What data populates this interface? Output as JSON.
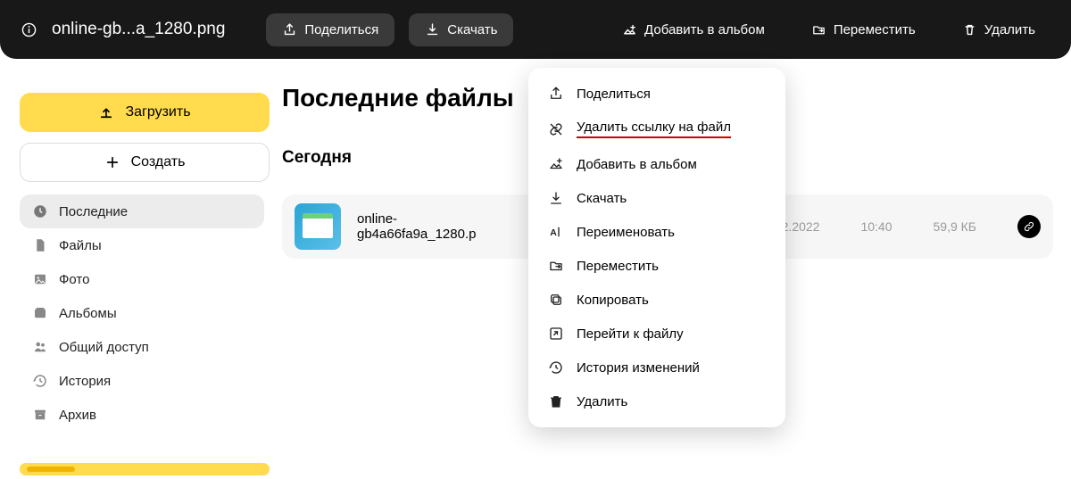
{
  "topbar": {
    "filename": "online-gb...a_1280.png",
    "share": "Поделиться",
    "download": "Скачать",
    "add_album": "Добавить в альбом",
    "move": "Переместить",
    "delete": "Удалить"
  },
  "sidebar": {
    "upload": "Загрузить",
    "create": "Создать",
    "items": [
      {
        "label": "Последние",
        "icon": "clock"
      },
      {
        "label": "Файлы",
        "icon": "file"
      },
      {
        "label": "Фото",
        "icon": "image"
      },
      {
        "label": "Альбомы",
        "icon": "album"
      },
      {
        "label": "Общий доступ",
        "icon": "shared"
      },
      {
        "label": "История",
        "icon": "history"
      },
      {
        "label": "Архив",
        "icon": "archive"
      }
    ]
  },
  "content": {
    "title": "Последние файлы",
    "section": "Сегодня",
    "file": {
      "name": "online-gb4a66fa9a_1280.p",
      "date": "14.12.2022",
      "time": "10:40",
      "size": "59,9 КБ"
    }
  },
  "context_menu": [
    {
      "label": "Поделиться",
      "icon": "share"
    },
    {
      "label": "Удалить ссылку на файл",
      "icon": "unlink",
      "highlight": true
    },
    {
      "label": "Добавить в альбом",
      "icon": "album-add"
    },
    {
      "label": "Скачать",
      "icon": "download"
    },
    {
      "label": "Переименовать",
      "icon": "rename"
    },
    {
      "label": "Переместить",
      "icon": "move"
    },
    {
      "label": "Копировать",
      "icon": "copy"
    },
    {
      "label": "Перейти к файлу",
      "icon": "goto"
    },
    {
      "label": "История изменений",
      "icon": "history"
    },
    {
      "label": "Удалить",
      "icon": "trash"
    }
  ]
}
